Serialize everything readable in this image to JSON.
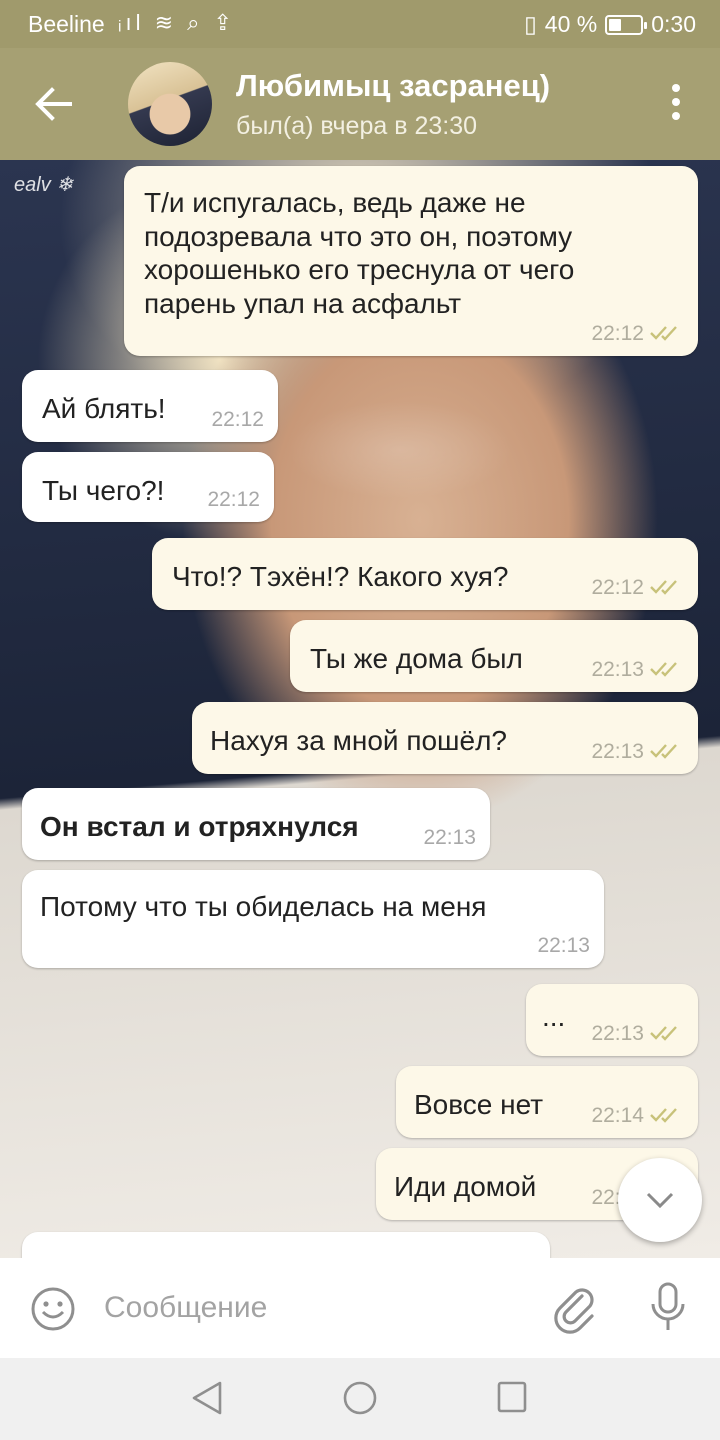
{
  "status_bar": {
    "carrier": "Beeline",
    "battery": "40 %",
    "time": "0:30",
    "battery_level": 0.4
  },
  "header": {
    "title": "Любимыц засранец)",
    "subtitle": "был(а) вчера в 23:30"
  },
  "wallpaper_watermark": "ealv ❄",
  "messages": [
    {
      "side": "out",
      "text": "Т/и испугалась, ведь даже не подозревала что это он, поэтому хорошенько его треснула от чего парень упал на асфальт",
      "time": "22:12",
      "read": true
    },
    {
      "side": "in",
      "text": "Ай блять!",
      "time": "22:12"
    },
    {
      "side": "in",
      "text": "Ты чего?!",
      "time": "22:12"
    },
    {
      "side": "out",
      "text": "Что!? Тэхён!? Какого хуя?",
      "time": "22:12",
      "read": true
    },
    {
      "side": "out",
      "text": "Ты же дома был",
      "time": "22:13",
      "read": true
    },
    {
      "side": "out",
      "text": "Нахуя за мной пошёл?",
      "time": "22:13",
      "read": true
    },
    {
      "side": "in",
      "text": "Он встал и отряхнулся",
      "time": "22:13",
      "bold": true
    },
    {
      "side": "in",
      "text": "Потому что ты обиделась на меня",
      "time": "22:13"
    },
    {
      "side": "out",
      "text": "...",
      "time": "22:13",
      "read": true
    },
    {
      "side": "out",
      "text": "Вовсе нет",
      "time": "22:14",
      "read": true
    },
    {
      "side": "out",
      "text": "Иди домой",
      "time": "22:14",
      "read": true
    }
  ],
  "composer": {
    "placeholder": "Сообщение"
  },
  "colors": {
    "header_bg": "#a6a073",
    "statusbar_bg": "#a09a6c",
    "outgoing_bubble": "#fdf8e8",
    "incoming_bubble": "#ffffff",
    "read_check": "#c8c27a"
  }
}
